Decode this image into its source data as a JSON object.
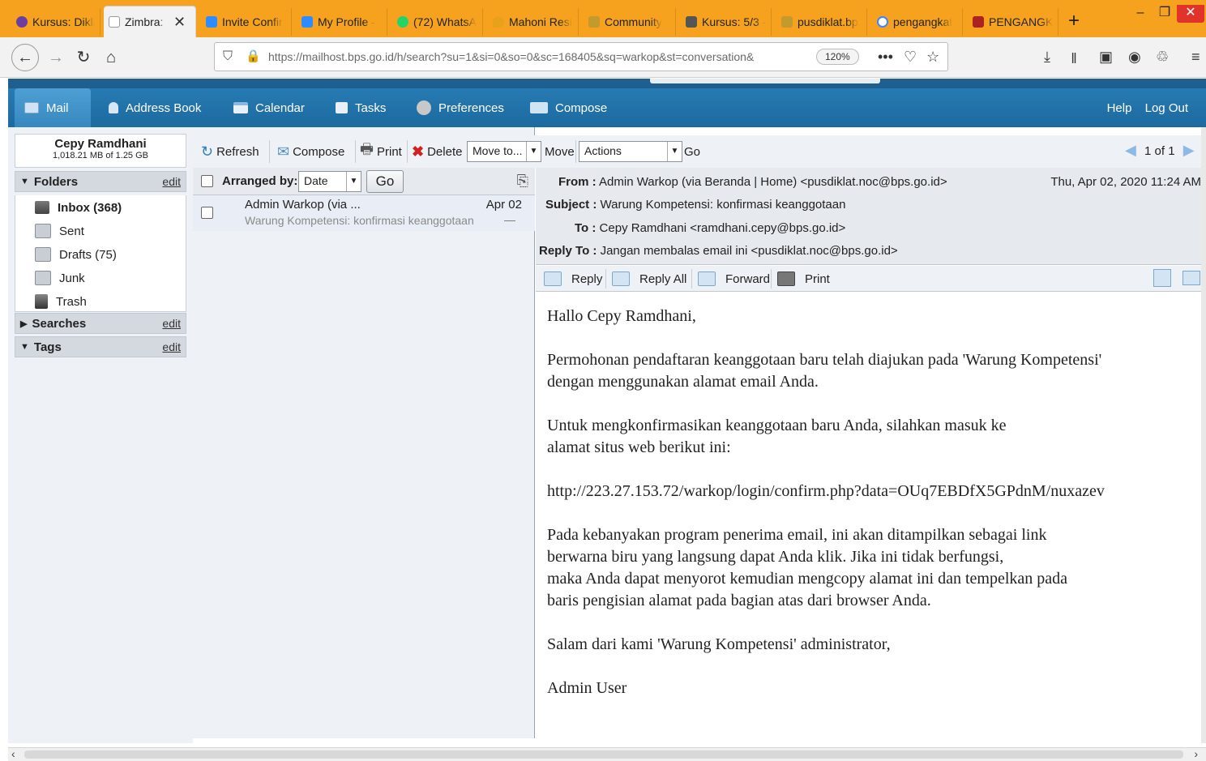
{
  "browser": {
    "tabs": [
      {
        "label": "Kursus: Dikla",
        "favicon_color": "#6b3fa0",
        "icon": "moodle-icon"
      },
      {
        "label": "Zimbra: ",
        "favicon_color": "#999999",
        "icon": "zimbra-icon",
        "active": true
      },
      {
        "label": "Invite Confir",
        "favicon_color": "#2d8cff",
        "icon": "zoom-icon"
      },
      {
        "label": "My Profile -",
        "favicon_color": "#2d8cff",
        "icon": "zoom-icon"
      },
      {
        "label": "(72) WhatsA",
        "favicon_color": "#25d366",
        "icon": "whatsapp-icon"
      },
      {
        "label": "Mahoni Resi",
        "favicon_color": "#e9a11b",
        "icon": "maps-pin-icon"
      },
      {
        "label": "Community",
        "favicon_color": "#c49a2c",
        "icon": "community-icon"
      },
      {
        "label": "Kursus: 5/3 -",
        "favicon_color": "#555555",
        "icon": "course-icon"
      },
      {
        "label": "pusdiklat.bp",
        "favicon_color": "#c49a2c",
        "icon": "pusdiklat-icon"
      },
      {
        "label": "pengangkat",
        "favicon_color": "#4285f4",
        "icon": "google-icon"
      },
      {
        "label": "PENGANGK",
        "favicon_color": "#a22",
        "icon": "gov-icon"
      }
    ],
    "tab_close": "✕",
    "new_tab": "+",
    "url": "https://mailhost.bps.go.id/h/search?su=1&si=0&so=0&sc=168405&sq=warkop&st=conversation&",
    "zoom": "120%"
  },
  "zimbra": {
    "nav": [
      {
        "label": "Mail",
        "icon": "mail-icon",
        "color": "#cfe3f3"
      },
      {
        "label": "Address Book",
        "icon": "address-book-icon",
        "color": "#d6e6f6"
      },
      {
        "label": "Calendar",
        "icon": "calendar-icon",
        "color": "#e8f1fa"
      },
      {
        "label": "Tasks",
        "icon": "tasks-icon",
        "color": "#e8f1fa"
      },
      {
        "label": "Preferences",
        "icon": "preferences-icon",
        "color": "#c8c8c8"
      },
      {
        "label": "Compose",
        "icon": "compose-icon",
        "color": "#d0e4f4"
      }
    ],
    "help": "Help",
    "logout": "Log Out"
  },
  "account": {
    "name": "Cepy Ramdhani",
    "quota": "1,018.21 MB of 1.25 GB"
  },
  "folders_head": {
    "label": "Folders",
    "edit": "edit"
  },
  "folders": [
    {
      "label": "Inbox (368)",
      "icon": "inbox-icon",
      "bold": true
    },
    {
      "label": "Sent",
      "icon": "sent-icon"
    },
    {
      "label": "Drafts (75)",
      "icon": "drafts-icon"
    },
    {
      "label": "Junk",
      "icon": "junk-icon"
    },
    {
      "label": "Trash",
      "icon": "trash-icon"
    }
  ],
  "searches_head": {
    "label": "Searches",
    "edit": "edit"
  },
  "tags_head": {
    "label": "Tags",
    "edit": "edit"
  },
  "toolbar": {
    "refresh": "Refresh",
    "compose": "Compose",
    "print": "Print",
    "delete": "Delete",
    "move_to": "Move to...",
    "move": "Move",
    "actions": "Actions",
    "go": "Go",
    "pager": "1 of 1"
  },
  "list": {
    "arranged_by": "Arranged by:",
    "sort": "Date",
    "go": "Go",
    "messages": [
      {
        "from": "Admin Warkop (via ...",
        "snippet": "Warung Kompetensi: konfirmasi keanggotaan",
        "date": "Apr 02",
        "dash": "—"
      }
    ]
  },
  "message": {
    "from_label": "From :",
    "from": "Admin Warkop (via Beranda | Home) <pusdiklat.noc@bps.go.id>",
    "date": "Thu, Apr 02, 2020 11:24 AM",
    "subject_label": "Subject :",
    "subject": "Warung Kompetensi: konfirmasi keanggotaan",
    "to_label": "To :",
    "to": "Cepy Ramdhani <ramdhani.cepy@bps.go.id>",
    "replyto_label": "Reply To :",
    "replyto": "Jangan membalas email ini <pusdiklat.noc@bps.go.id>",
    "actions": {
      "reply": "Reply",
      "reply_all": "Reply All",
      "forward": "Forward",
      "print": "Print"
    },
    "body": {
      "greeting": "Hallo Cepy Ramdhani,",
      "p1": "Permohonan pendaftaran keanggotaan baru telah diajukan pada 'Warung Kompetensi'\ndengan menggunakan alamat email Anda.",
      "p2": "Untuk mengkonfirmasikan keanggotaan baru Anda, silahkan masuk ke\nalamat situs web berikut ini:",
      "link": "http://223.27.153.72/warkop/login/confirm.php?data=OUq7EBDfX5GPdnM/nuxazev",
      "p3": "Pada kebanyakan program penerima email, ini akan ditampilkan sebagai link\nberwarna biru yang langsung dapat Anda klik. Jika ini tidak berfungsi,\nmaka Anda dapat menyorot kemudian mengcopy alamat ini dan tempelkan pada\nbaris pengisian alamat pada bagian atas dari browser Anda.",
      "p4": "Salam dari kami 'Warung Kompetensi' administrator,",
      "sign": "Admin User"
    }
  }
}
